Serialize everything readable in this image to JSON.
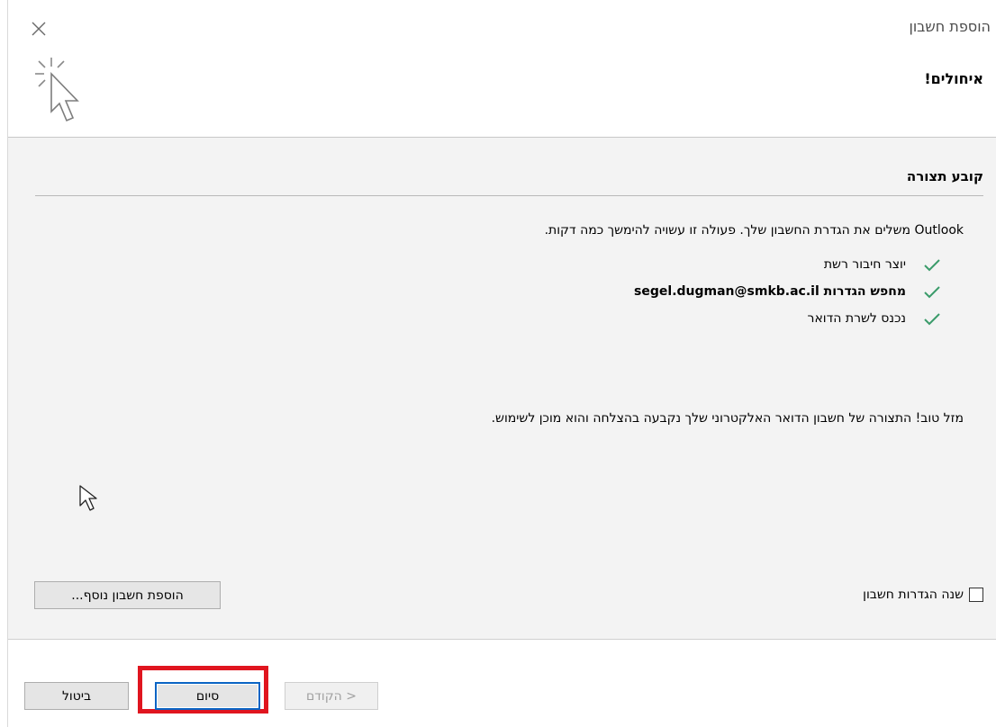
{
  "window": {
    "title": "הוספת חשבון",
    "heading": "איחולים!"
  },
  "section": {
    "title": "קובע תצורה",
    "info": "Outlook משלים את הגדרת החשבון שלך. פעולה זו עשויה להימשך כמה דקות."
  },
  "steps": [
    {
      "label": "יוצר חיבור רשת",
      "icon": "check-icon",
      "bold": false
    },
    {
      "label": "מחפש הגדרות segel.dugman@smkb.ac.il",
      "icon": "check-icon",
      "bold": true
    },
    {
      "label": "נכנס לשרת הדואר",
      "icon": "check-icon",
      "bold": false
    }
  ],
  "success_message": "מזל טוב! התצורה של חשבון הדואר האלקטרוני שלך נקבעה בהצלחה והוא מוכן לשימוש.",
  "options": {
    "change_settings_label": "שנה הגדרות חשבון",
    "change_settings_checked": false,
    "add_account_label": "הוספת חשבון נוסף..."
  },
  "footer": {
    "cancel_label": "ביטול",
    "finish_label": "סיום",
    "prev_label": "< הקודם"
  },
  "colors": {
    "highlight": "#e0151f",
    "check": "#3a9b6a",
    "focus": "#0a64c4"
  }
}
